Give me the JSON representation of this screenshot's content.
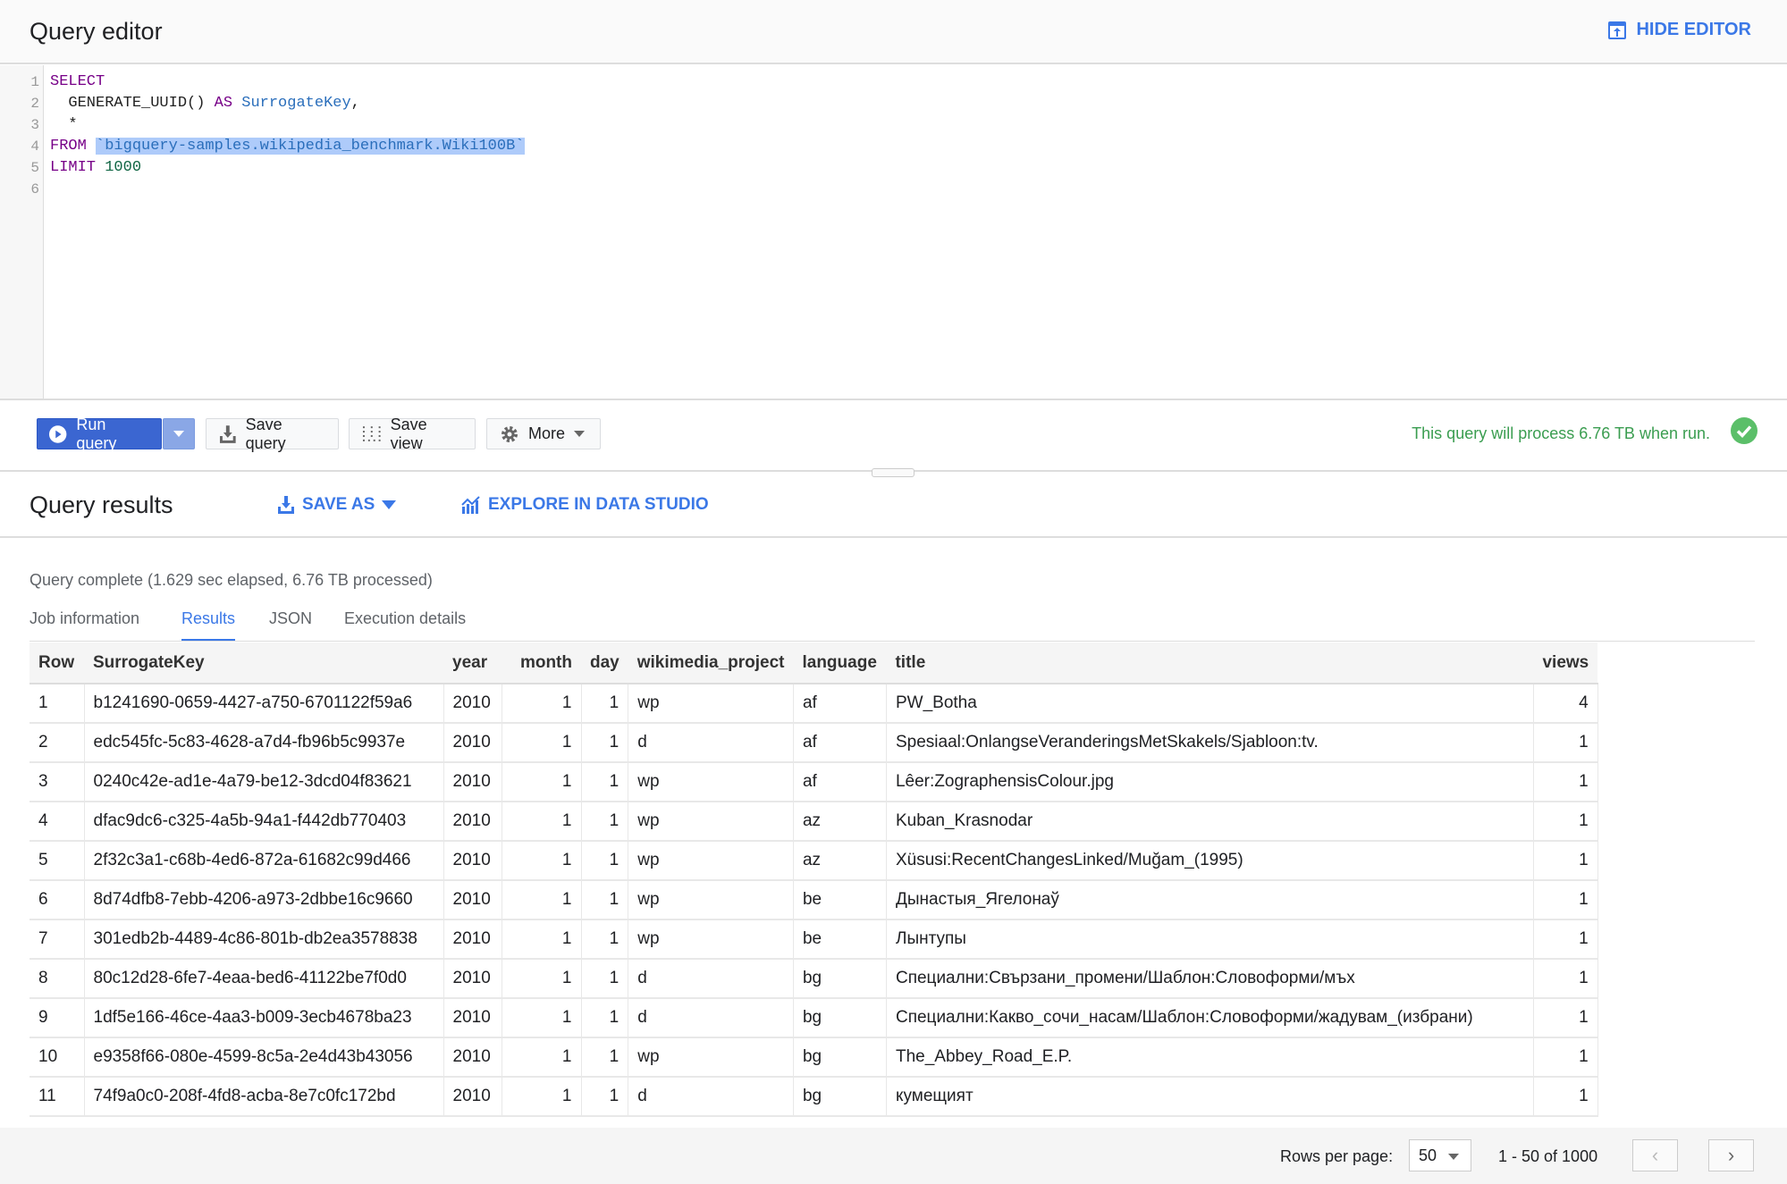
{
  "header": {
    "title": "Query editor",
    "hide_editor": "HIDE EDITOR"
  },
  "editor": {
    "lines": [
      "1",
      "2",
      "3",
      "4",
      "5",
      "6"
    ],
    "code": {
      "select": "SELECT",
      "generate": "  GENERATE_UUID() ",
      "as": "AS",
      "alias": "SurrogateKey",
      "comma": ",",
      "star": "  *",
      "from": "FROM",
      "table": "`bigquery-samples.wikipedia_benchmark.Wiki100B`",
      "limit": "LIMIT",
      "limit_value": "1000"
    }
  },
  "toolbar": {
    "run": "Run query",
    "save_query": "Save query",
    "save_view": "Save view",
    "more": "More",
    "status": "This query will process 6.76 TB when run.",
    "status_color": "#3a9d50"
  },
  "results": {
    "title": "Query results",
    "save_as": "SAVE AS",
    "explore": "EXPLORE IN DATA STUDIO",
    "complete": "Query complete (1.629 sec elapsed, 6.76 TB processed)",
    "tabs": [
      "Job information",
      "Results",
      "JSON",
      "Execution details"
    ],
    "active_tab": "Results"
  },
  "table": {
    "columns": [
      "Row",
      "SurrogateKey",
      "year",
      "month",
      "day",
      "wikimedia_project",
      "language",
      "title",
      "views"
    ],
    "rows": [
      [
        "1",
        "b1241690-0659-4427-a750-6701122f59a6",
        "2010",
        "1",
        "1",
        "wp",
        "af",
        "PW_Botha",
        "4"
      ],
      [
        "2",
        "edc545fc-5c83-4628-a7d4-fb96b5c9937e",
        "2010",
        "1",
        "1",
        "d",
        "af",
        "Spesiaal:OnlangseVeranderingsMetSkakels/Sjabloon:tv.",
        "1"
      ],
      [
        "3",
        "0240c42e-ad1e-4a79-be12-3dcd04f83621",
        "2010",
        "1",
        "1",
        "wp",
        "af",
        "Lêer:ZographensisColour.jpg",
        "1"
      ],
      [
        "4",
        "dfac9dc6-c325-4a5b-94a1-f442db770403",
        "2010",
        "1",
        "1",
        "wp",
        "az",
        "Kuban_Krasnodar",
        "1"
      ],
      [
        "5",
        "2f32c3a1-c68b-4ed6-872a-61682c99d466",
        "2010",
        "1",
        "1",
        "wp",
        "az",
        "Xüsusi:RecentChangesLinked/Muğam_(1995)",
        "1"
      ],
      [
        "6",
        "8d74dfb8-7ebb-4206-a973-2dbbe16c9660",
        "2010",
        "1",
        "1",
        "wp",
        "be",
        "Дынастыя_Ягелонаў",
        "1"
      ],
      [
        "7",
        "301edb2b-4489-4c86-801b-db2ea3578838",
        "2010",
        "1",
        "1",
        "wp",
        "be",
        "Лынтупы",
        "1"
      ],
      [
        "8",
        "80c12d28-6fe7-4eaa-bed6-41122be7f0d0",
        "2010",
        "1",
        "1",
        "d",
        "bg",
        "Специални:Свързани_промени/Шаблон:Словоформи/мъх",
        "1"
      ],
      [
        "9",
        "1df5e166-46ce-4aa3-b009-3ecb4678ba23",
        "2010",
        "1",
        "1",
        "d",
        "bg",
        "Специални:Какво_сочи_насам/Шаблон:Словоформи/жадувам_(избрани)",
        "1"
      ],
      [
        "10",
        "e9358f66-080e-4599-8c5a-2e4d43b43056",
        "2010",
        "1",
        "1",
        "wp",
        "bg",
        "The_Abbey_Road_E.P.",
        "1"
      ],
      [
        "11",
        "74f9a0c0-208f-4fd8-acba-8e7c0fc172bd",
        "2010",
        "1",
        "1",
        "d",
        "bg",
        "кумещият",
        "1"
      ]
    ]
  },
  "pagination": {
    "rows_per_page_label": "Rows per page:",
    "rows_per_page": "50",
    "range": "1 - 50 of 1000",
    "prev": "‹",
    "next": "›"
  },
  "colors": {
    "accent": "#3b78e7",
    "run_button": "#3b66d1",
    "success": "#5bbf69"
  }
}
